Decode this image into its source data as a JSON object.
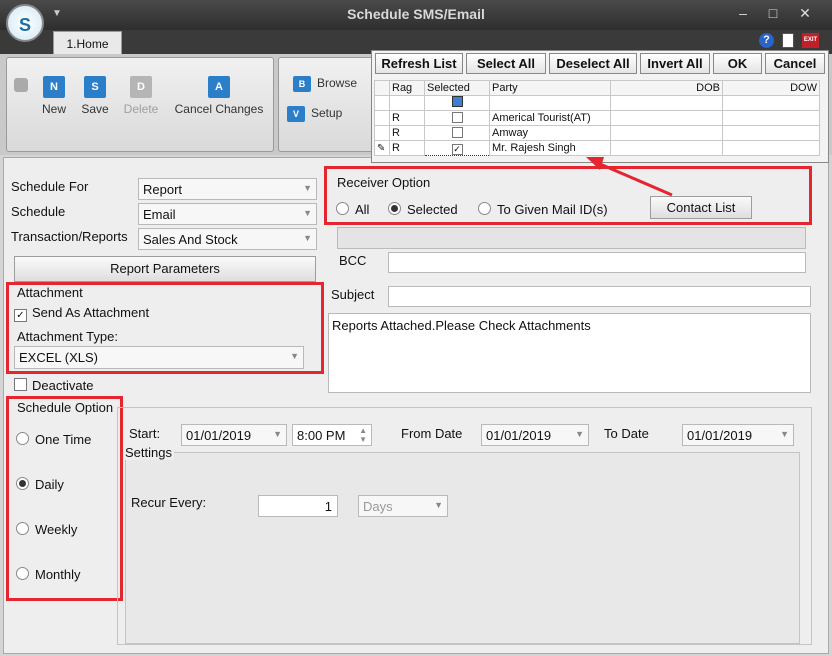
{
  "window": {
    "title": "Schedule SMS/Email",
    "home_tab": "1.Home",
    "minimize": "–",
    "maximize": "□",
    "close": "✕",
    "menu_arrow": "▼",
    "help_icon": "?",
    "exit_icon": "EXIT"
  },
  "ribbon": {
    "new": "New",
    "save": "Save",
    "delete": "Delete",
    "cancel": "Cancel Changes",
    "browse": "Browse",
    "setup": "Setup"
  },
  "grid_popup": {
    "buttons": [
      "Refresh List",
      "Select All",
      "Deselect All",
      "Invert All",
      "OK",
      "Cancel"
    ],
    "columns": [
      "Rag",
      "Selected",
      "Party",
      "DOB",
      "DOW"
    ],
    "rows": [
      {
        "rag": "R",
        "selected": false,
        "party": "Americal Tourist(AT)"
      },
      {
        "rag": "R",
        "selected": false,
        "party": "Amway"
      },
      {
        "rag": "R",
        "selected": true,
        "party": "Mr. Rajesh Singh"
      }
    ]
  },
  "form": {
    "schedule_for_label": "Schedule For",
    "schedule_for_value": "Report",
    "schedule_label": "Schedule",
    "schedule_value": "Email",
    "transaction_label": "Transaction/Reports",
    "transaction_value": "Sales And Stock",
    "report_params_btn": "Report Parameters",
    "attachment_group": "Attachment",
    "send_as_attachment": "Send As Attachment",
    "attachment_type_label": "Attachment Type:",
    "attachment_type_value": "EXCEL (XLS)",
    "deactivate": "Deactivate",
    "schedule_option_group": "Schedule Option",
    "schedule_options": [
      "One Time",
      "Daily",
      "Weekly",
      "Monthly"
    ],
    "schedule_selected": "Daily",
    "receiver_group": "Receiver Option",
    "receiver_options": [
      "All",
      "Selected",
      "To Given Mail ID(s)"
    ],
    "receiver_selected": "Selected",
    "contact_list_btn": "Contact List",
    "bcc_label": "BCC",
    "bcc_value": "",
    "subject_label": "Subject",
    "subject_value": "",
    "body": "Reports Attached.Please Check Attachments",
    "start_label": "Start:",
    "start_date": "01/01/2019",
    "start_time": "8:00 PM",
    "from_label": "From Date",
    "from_date": "01/01/2019",
    "to_label": "To Date",
    "to_date": "01/01/2019",
    "settings_label": "Settings",
    "recur_label": "Recur Every:",
    "recur_value": "1",
    "recur_unit": "Days"
  },
  "colors": {
    "highlight_red": "#e3262f",
    "accent_blue": "#2b7fc8"
  }
}
